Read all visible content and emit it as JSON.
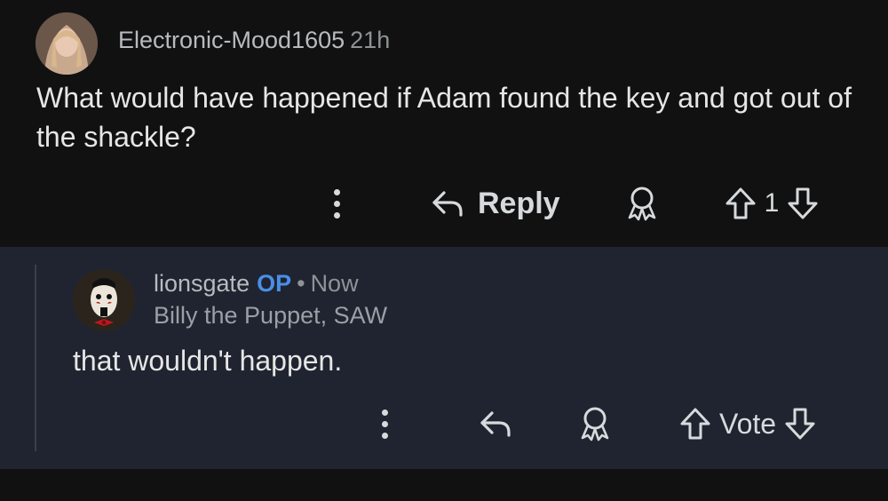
{
  "comment1": {
    "username": "Electronic-Mood1605",
    "time": "21h",
    "body": "What would have happened if Adam found the key and got out of the shackle?",
    "reply_label": "Reply",
    "vote_count": "1"
  },
  "comment2": {
    "username": "lionsgate",
    "op_badge": "OP",
    "separator": "•",
    "time": "Now",
    "flair": "Billy the Puppet, SAW",
    "body": "that wouldn't happen.",
    "vote_label": "Vote"
  },
  "icons": {
    "more": "more-vertical-icon",
    "reply": "reply-arrow-icon",
    "award": "award-icon",
    "upvote": "upvote-arrow-icon",
    "downvote": "downvote-arrow-icon"
  },
  "colors": {
    "background": "#121112",
    "reply_background": "#1f2430",
    "op_badge": "#4a8fe7",
    "text": "#d7dadc"
  }
}
